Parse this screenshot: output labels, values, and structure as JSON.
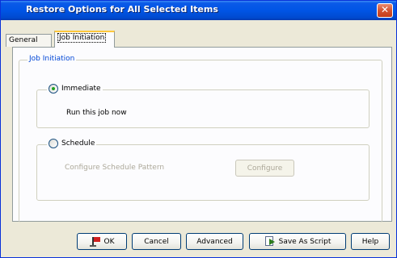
{
  "window": {
    "title": "Restore Options for All Selected Items",
    "close_glyph": "✕"
  },
  "tabs": [
    {
      "label": "General",
      "selected": false
    },
    {
      "label": "Job Initiation",
      "selected": true
    }
  ],
  "job_initiation": {
    "group_label": "Job Initiation",
    "immediate": {
      "label": "Immediate",
      "checked": true,
      "description": "Run this job now"
    },
    "schedule": {
      "label": "Schedule",
      "checked": false,
      "pattern_label": "Configure Schedule Pattern",
      "configure_button": "Configure"
    }
  },
  "buttons": {
    "ok": "OK",
    "cancel": "Cancel",
    "advanced": "Advanced",
    "save_as_script": "Save As Script",
    "help": "Help"
  },
  "icons": {
    "ok": "flag-icon",
    "save_as_script": "script-icon"
  },
  "colors": {
    "title_bar": "#0055e5",
    "group_label": "#0046d5",
    "disabled_text": "#aca899",
    "radio_check": "#21a121"
  }
}
